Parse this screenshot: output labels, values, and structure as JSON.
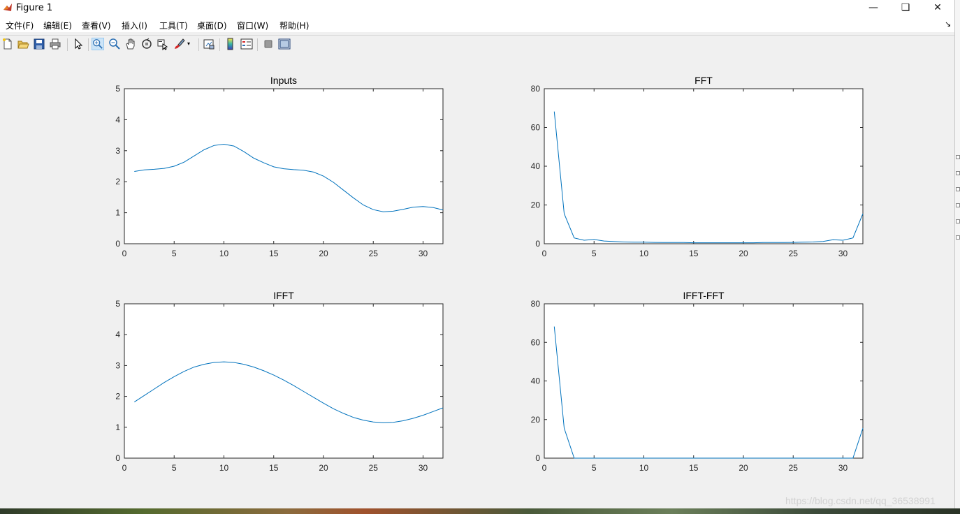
{
  "window": {
    "title": "Figure 1"
  },
  "menu": [
    "文件(F)",
    "编辑(E)",
    "查看(V)",
    "插入(I)",
    "工具(T)",
    "桌面(D)",
    "窗口(W)",
    "帮助(H)"
  ],
  "toolbar": {
    "icons": [
      "new-figure-icon",
      "open-file-icon",
      "save-icon",
      "print-icon",
      "edit-plot-icon",
      "zoom-in-icon",
      "zoom-out-icon",
      "pan-icon",
      "rotate-3d-icon",
      "data-cursor-icon",
      "brush-icon",
      "link-plot-icon",
      "insert-colorbar-icon",
      "insert-legend-icon",
      "hide-plot-tools-icon",
      "show-plot-tools-icon"
    ],
    "active": "zoom-in-icon"
  },
  "watermark": "https://blog.csdn.net/qq_36538991",
  "colors": {
    "line": "#0072bd",
    "axes_bg": "#ffffff",
    "figure_bg": "#f0f0f0"
  },
  "chart_data": [
    {
      "type": "line",
      "title": "Inputs",
      "xlim": [
        0,
        32
      ],
      "ylim": [
        0,
        5
      ],
      "xticks": [
        0,
        5,
        10,
        15,
        20,
        25,
        30
      ],
      "yticks": [
        0,
        1,
        2,
        3,
        4,
        5
      ],
      "x": [
        1,
        2,
        3,
        4,
        5,
        6,
        7,
        8,
        9,
        10,
        11,
        12,
        13,
        14,
        15,
        16,
        17,
        18,
        19,
        20,
        21,
        22,
        23,
        24,
        25,
        26,
        27,
        28,
        29,
        30,
        31,
        32
      ],
      "values": [
        2.33,
        2.38,
        2.4,
        2.43,
        2.5,
        2.63,
        2.83,
        3.03,
        3.17,
        3.21,
        3.15,
        2.97,
        2.76,
        2.61,
        2.48,
        2.42,
        2.39,
        2.37,
        2.31,
        2.18,
        1.98,
        1.73,
        1.48,
        1.25,
        1.1,
        1.03,
        1.05,
        1.11,
        1.18,
        1.2,
        1.17,
        1.09
      ]
    },
    {
      "type": "line",
      "title": "FFT",
      "xlim": [
        0,
        32
      ],
      "ylim": [
        0,
        80
      ],
      "xticks": [
        0,
        5,
        10,
        15,
        20,
        25,
        30
      ],
      "yticks": [
        0,
        20,
        40,
        60,
        80
      ],
      "x": [
        1,
        2,
        3,
        4,
        5,
        6,
        7,
        8,
        9,
        10,
        11,
        12,
        13,
        14,
        15,
        16,
        17,
        18,
        19,
        20,
        21,
        22,
        23,
        24,
        25,
        26,
        27,
        28,
        29,
        30,
        31,
        32
      ],
      "values": [
        68.2,
        15.5,
        3.0,
        1.8,
        2.2,
        1.4,
        1.1,
        0.9,
        0.8,
        0.8,
        0.7,
        0.6,
        0.6,
        0.6,
        0.5,
        0.5,
        0.5,
        0.5,
        0.5,
        0.5,
        0.5,
        0.6,
        0.6,
        0.6,
        0.7,
        0.8,
        0.9,
        1.2,
        2.1,
        1.8,
        3.0,
        15.5
      ]
    },
    {
      "type": "line",
      "title": "IFFT",
      "xlim": [
        0,
        32
      ],
      "ylim": [
        0,
        5
      ],
      "xticks": [
        0,
        5,
        10,
        15,
        20,
        25,
        30
      ],
      "yticks": [
        0,
        1,
        2,
        3,
        4,
        5
      ],
      "x": [
        1,
        2,
        3,
        4,
        5,
        6,
        7,
        8,
        9,
        10,
        11,
        12,
        13,
        14,
        15,
        16,
        17,
        18,
        19,
        20,
        21,
        22,
        23,
        24,
        25,
        26,
        27,
        28,
        29,
        30,
        31,
        32
      ],
      "values": [
        1.82,
        2.03,
        2.24,
        2.45,
        2.64,
        2.81,
        2.95,
        3.04,
        3.1,
        3.12,
        3.1,
        3.04,
        2.95,
        2.83,
        2.69,
        2.53,
        2.35,
        2.16,
        1.97,
        1.78,
        1.6,
        1.45,
        1.32,
        1.23,
        1.17,
        1.15,
        1.16,
        1.21,
        1.29,
        1.39,
        1.51,
        1.63
      ]
    },
    {
      "type": "line",
      "title": "IFFT-FFT",
      "xlim": [
        0,
        32
      ],
      "ylim": [
        0,
        80
      ],
      "xticks": [
        0,
        5,
        10,
        15,
        20,
        25,
        30
      ],
      "yticks": [
        0,
        20,
        40,
        60,
        80
      ],
      "x": [
        1,
        2,
        3,
        4,
        5,
        6,
        7,
        8,
        9,
        10,
        11,
        12,
        13,
        14,
        15,
        16,
        17,
        18,
        19,
        20,
        21,
        22,
        23,
        24,
        25,
        26,
        27,
        28,
        29,
        30,
        31,
        32
      ],
      "values": [
        68.2,
        15.5,
        0,
        0,
        0,
        0,
        0,
        0,
        0,
        0,
        0,
        0,
        0,
        0,
        0,
        0,
        0,
        0,
        0,
        0,
        0,
        0,
        0,
        0,
        0,
        0,
        0,
        0,
        0,
        0,
        0,
        15.5
      ]
    }
  ]
}
